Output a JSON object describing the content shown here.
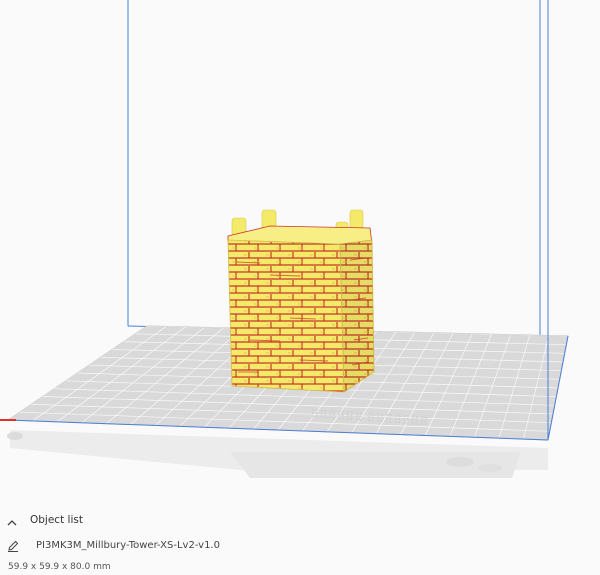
{
  "object_list": {
    "label": "Object list",
    "toggle_icon": "chevron-up-icon"
  },
  "selected_object": {
    "name": "PI3MK3M_Millbury-Tower-XS-Lv2-v1.0",
    "edit_icon": "pencil-icon",
    "dimensions": "59.9 x 59.9 x 80.0 mm"
  },
  "colors": {
    "build_volume_line": "#4a7fd6",
    "build_plate": "#d9d9d9",
    "grid_line": "#ffffff",
    "model_fill": "#f4ea6a",
    "model_overhang": "#c8362b",
    "x_axis": "#e0302a"
  }
}
